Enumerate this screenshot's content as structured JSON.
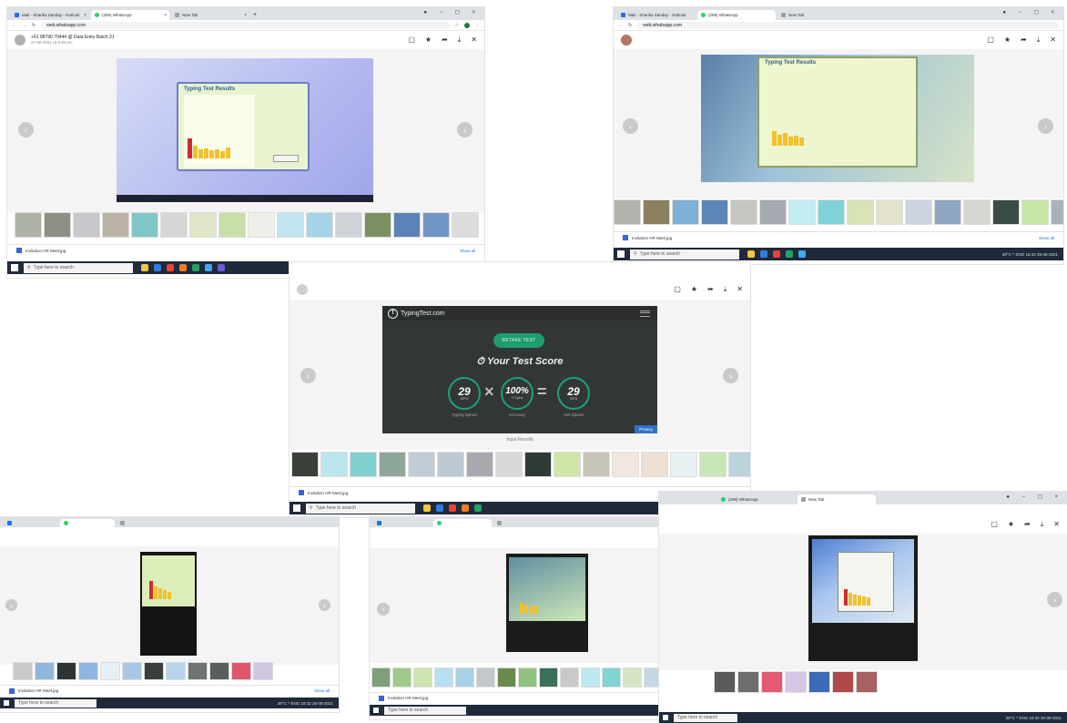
{
  "browser": {
    "tabs": [
      "Mail - Sharika Sanday - Outlook",
      "(299) WhatsApp",
      "New Tab"
    ],
    "url": "web.whatsapp.com"
  },
  "message": {
    "sender": "+91 98790 70444 @ Data Entry Batch 21",
    "date": "27-08-2021 at 9:35 pm"
  },
  "download": {
    "file": "Invitation HR Meet.jpg",
    "show_all": "Show all"
  },
  "taskbar": {
    "search_placeholder": "Type here to search",
    "tray": "28°C  ^  ENG  18:32  26-08-2021"
  },
  "typing_results": {
    "title": "Typing Test Results"
  },
  "typingtest": {
    "brand": "TypingTest.com",
    "retake": "RETAKE TEST",
    "title": "Your Test Score",
    "wpm": "29",
    "wpm_unit": "WPM",
    "accuracy": "100%",
    "accuracy_unit": "C Spins",
    "net": "29",
    "net_unit": "WPM",
    "label_speed": "Typing Speed",
    "label_accuracy": "Accuracy",
    "label_net": "Net Speed",
    "privacy": "Privacy",
    "caption": "Input Results"
  },
  "colors": {
    "whatsapp": "#25d366",
    "tt_accent": "#19a47a",
    "bar": "#f2c12e",
    "bar_red": "#d12b2b"
  }
}
